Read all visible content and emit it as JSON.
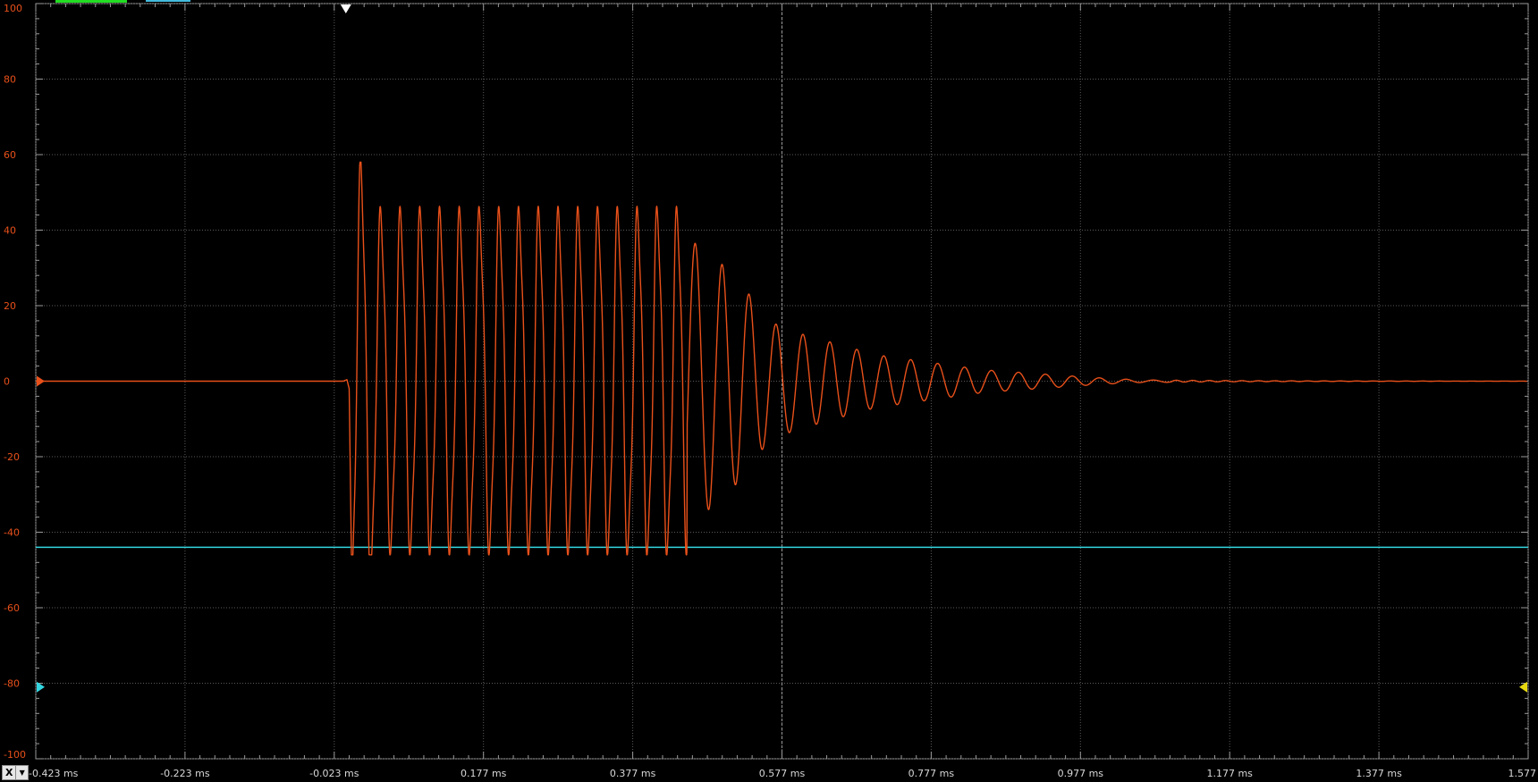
{
  "colors": {
    "background": "#000000",
    "grid": "#5a5a5a",
    "axis": "#9a9a9a",
    "signal": "#e8501a",
    "ytick_label": "#e8501a",
    "xtick_label": "#d8d8d8",
    "threshold_line": "#33d6e0",
    "ch1_marker": "#e8501a",
    "ch2_marker": "#33d6e0",
    "right_marker": "#e8d810",
    "trigger_marker": "#ffffff",
    "top_indicator_1": "#22dd22",
    "top_indicator_2": "#44bbdd"
  },
  "axis_selector": {
    "label": "X",
    "dropdown_icon": "triangle-down-icon"
  },
  "chart_data": {
    "type": "line",
    "title": "",
    "xlabel": "",
    "ylabel": "",
    "xlim": [
      -0.423,
      1.577
    ],
    "ylim": [
      -100,
      100
    ],
    "x_unit": "ms",
    "x_ticks": [
      -0.423,
      -0.223,
      -0.023,
      0.177,
      0.377,
      0.577,
      0.777,
      0.977,
      1.177,
      1.377,
      1.577
    ],
    "x_tick_labels": [
      "-0.423 ms",
      "-0.223 ms",
      "-0.023 ms",
      "0.177 ms",
      "0.377 ms",
      "0.577 ms",
      "0.777 ms",
      "0.977 ms",
      "1.177 ms",
      "1.377 ms",
      "1.577"
    ],
    "y_ticks": [
      100,
      80,
      60,
      40,
      20,
      0,
      -20,
      -40,
      -60,
      -80,
      -100
    ],
    "y_tick_labels": [
      "100",
      "80",
      "60",
      "40",
      "20",
      "0",
      "-20",
      "-40",
      "-60",
      "-80",
      "-100"
    ],
    "grid": true,
    "grid_style": "dotted",
    "vertical_reference_x": 0.577,
    "series": [
      {
        "signal_start": 0.0,
        "burst_end": 0.45,
        "burst_cycles": 17,
        "burst_amplitude_top": 44,
        "burst_amplitude_bottom": -44,
        "initial_peak": 58,
        "initial_trough": -46,
        "decay_peaks": [
          38,
          33,
          26,
          16,
          13,
          11,
          9,
          7,
          6,
          5,
          4,
          3,
          2.5,
          2,
          1.5,
          1,
          0.6,
          0.3
        ],
        "decay_end": 1.1
      }
    ],
    "reference_lines": [
      {
        "axis": "y",
        "value": -44
      }
    ],
    "markers": {
      "ch1_level": 0,
      "ch2_level": -81,
      "right_level": -81,
      "trigger_x": -0.023
    }
  }
}
